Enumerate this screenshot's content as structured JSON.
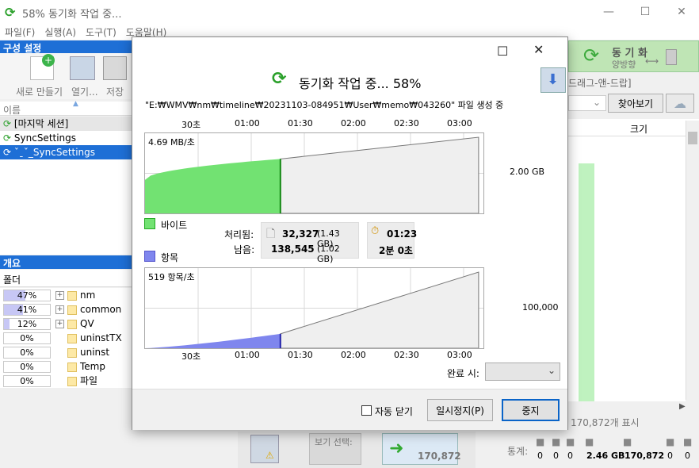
{
  "window": {
    "title": "58% 동기화 작업 중...",
    "minimize": "—",
    "maximize": "☐",
    "close": "✕"
  },
  "menu": [
    "파일(F)",
    "실행(A)",
    "도구(T)",
    "도움말(H)"
  ],
  "left": {
    "config_header": "구성 설정",
    "toolbar": {
      "new": "새로 만들기",
      "open": "열기...",
      "save": "저장"
    },
    "name_col": "이름",
    "items": [
      "[마지막 세션]",
      "SyncSettings",
      "ˇˍˇ_SyncSettings"
    ],
    "overview_header": "개요",
    "folder_col": "폴더",
    "rows": [
      {
        "pct": "47%",
        "frac": 0.47,
        "expand": true,
        "name": "nm"
      },
      {
        "pct": "41%",
        "frac": 0.41,
        "expand": true,
        "name": "common"
      },
      {
        "pct": "12%",
        "frac": 0.12,
        "expand": true,
        "name": "QV"
      },
      {
        "pct": "0%",
        "frac": 0,
        "expand": false,
        "name": "uninstTX"
      },
      {
        "pct": "0%",
        "frac": 0,
        "expand": false,
        "name": "uninst"
      },
      {
        "pct": "0%",
        "frac": 0,
        "expand": false,
        "name": "Temp"
      },
      {
        "pct": "0%",
        "frac": 0,
        "expand": false,
        "name": "파일"
      }
    ]
  },
  "right": {
    "sync_label": "동 기 화",
    "direction": "양방향",
    "dragdrop": "드래그-앤-드랍]",
    "find": "찾아보기",
    "size_col": "크기",
    "shown_count": "170,872개 표시"
  },
  "bottom": {
    "view_select": "보기 선택:",
    "count": "170,872",
    "stats_label": "통계:",
    "stats": [
      "0",
      "0",
      "0",
      "2.46 GB",
      "170,872",
      "0",
      "0"
    ]
  },
  "dialog": {
    "title": "동기화 작업 중... 58%",
    "status_path": "\"E:₩WMV₩nm₩timeline₩20231103-084951₩User₩memo₩043260\" 파일 생성 중",
    "time_ticks": [
      "30초",
      "01:00",
      "01:30",
      "02:00",
      "02:30",
      "03:00"
    ],
    "bytes_rate": "4.69 MB/초",
    "bytes_total_label": "2.00 GB",
    "bytes_legend": "바이트",
    "items_legend": "항목",
    "items_rate": "519 항목/초",
    "items_total_label": "100,000",
    "processed_label": "처리됨:",
    "remaining_label": "남음:",
    "processed_count": "32,327",
    "processed_size": "(1.43 GB)",
    "remaining_count": "138,545",
    "remaining_size": "(1.02 GB)",
    "elapsed": "01:23",
    "remaining_time": "2분 0초",
    "on_complete_label": "완료 시:",
    "auto_close": "자동 닫기",
    "pause": "일시정지(P)",
    "stop": "중지",
    "colors": {
      "bytes": "#72e272",
      "items": "#7f86ee",
      "accent": "#0a64c8"
    }
  },
  "chart_data": [
    {
      "type": "area",
      "title": "",
      "series": [
        {
          "name": "바이트",
          "x": [
            0,
            84
          ],
          "y": [
            0.88,
            1.43
          ]
        }
      ],
      "projection": {
        "x": [
          84,
          207
        ],
        "y": [
          1.43,
          2.0
        ]
      },
      "ylim": [
        0,
        2.0
      ],
      "xlim": [
        0,
        210
      ],
      "rate": "4.69 MB/초",
      "ylabel": "2.00 GB"
    },
    {
      "type": "area",
      "title": "",
      "series": [
        {
          "name": "항목",
          "x": [
            0,
            84
          ],
          "y": [
            0,
            32327
          ]
        }
      ],
      "projection": {
        "x": [
          84,
          207
        ],
        "y": [
          32327,
          170872
        ]
      },
      "ylim": [
        0,
        170872
      ],
      "xlim": [
        0,
        210
      ],
      "rate": "519 항목/초",
      "ylabel": "100,000"
    }
  ]
}
